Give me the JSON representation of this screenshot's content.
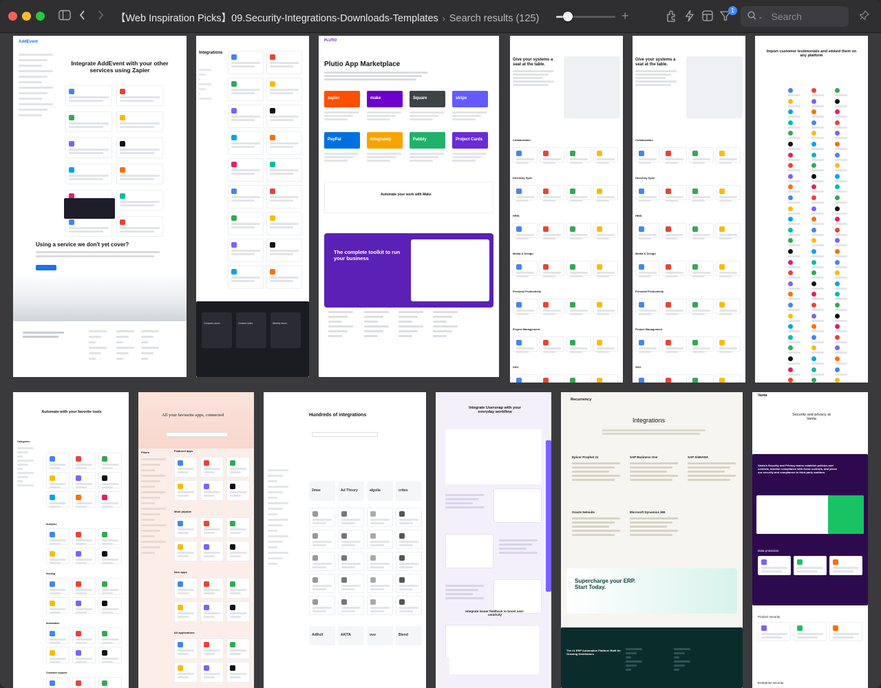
{
  "window": {
    "title": "【Web Inspiration Picks】09.Security-Integrations-Downloads-Templates",
    "subtitle": "Search results (125)"
  },
  "toolbar": {
    "zoom_level": 0.2,
    "filter_badge": "1",
    "search_placeholder": "Search",
    "icons": [
      "sidebar-icon",
      "back-icon",
      "forward-icon",
      "extensions-icon",
      "bolt-icon",
      "layout-icon",
      "filter-icon",
      "search-icon",
      "pin-icon"
    ]
  },
  "cards": [
    {
      "name": "addevent",
      "heading": "Integrate AddEvent with your other services using Zapier",
      "logo": "AddEvent",
      "sub_heading": "Using a service we don't yet cover?",
      "accent": "#1a73e8"
    },
    {
      "name": "integrations-list",
      "heading": "Integrations",
      "footer_items": [
        "Compare plans",
        "Contact sales",
        "Weekly demo"
      ]
    },
    {
      "name": "plutio",
      "logo": "PLUTIO",
      "heading": "Plutio App Marketplace",
      "tiles": [
        "zapier",
        "make",
        "Square",
        "stripe",
        "PayPal",
        "Integrately",
        "Pabbly",
        "Project Cards"
      ],
      "cta": "Automate your work with Make",
      "promo": "The complete toolkit to run your business",
      "accent": "#5b21b6"
    },
    {
      "name": "systems-a",
      "heading": "Give your systems a seat at the table.",
      "sections": [
        "Collaboration",
        "Directory Sync",
        "HRIS",
        "Media & Design",
        "Personal Productivity",
        "Project Management",
        "SSO"
      ]
    },
    {
      "name": "systems-b",
      "heading": "Give your systems a seat at the table.",
      "sections": [
        "Collaboration",
        "Directory Sync",
        "HRIS",
        "Media & Design",
        "Personal Productivity",
        "Project Management",
        "SSO"
      ]
    },
    {
      "name": "testimonials",
      "heading": "Import customer testimonials and embed them on any platform"
    },
    {
      "name": "automate",
      "heading": "Automate with your favorite tools",
      "sections": [
        "Categories",
        "Analytics",
        "Hosting",
        "Automation",
        "Customer support"
      ]
    },
    {
      "name": "people",
      "heading": "All your favourite apps, connected",
      "sections": [
        "Filters",
        "Featured apps",
        "Most popular",
        "New apps",
        "All applications"
      ]
    },
    {
      "name": "segment",
      "heading": "Hundreds of integrations",
      "logos": [
        "2mee",
        "Ad Theory",
        "algolia",
        "criteo",
        "AdRoll",
        "AKITA",
        "ovo",
        "Blend"
      ]
    },
    {
      "name": "usersnap",
      "heading": "Integrate Usersnap with your everyday workflow",
      "sub_heading": "Integrate issuer feedback to boost user-centricity"
    },
    {
      "name": "recurrency",
      "logo": "Recurrency",
      "heading": "Integrations",
      "items": [
        "Epicor Prophet 21",
        "SAP Business One",
        "SAP S/4HANA",
        "Oracle Netsuite",
        "Microsoft Dynamics 365"
      ],
      "cta": "Supercharge your ERP. Start Today.",
      "footer": "The #1 ERP Automation Platform Built for Growing Distributors"
    },
    {
      "name": "vanta",
      "logo": "Vanta",
      "heading": "Security and privacy at Vanta",
      "body": "Vanta's Security and Privacy teams establish policies and controls, monitor compliance with those controls, and prove our security and compliance to third-party auditors.",
      "sections": [
        "Data protection",
        "Product security",
        "Enterprise security"
      ]
    }
  ]
}
